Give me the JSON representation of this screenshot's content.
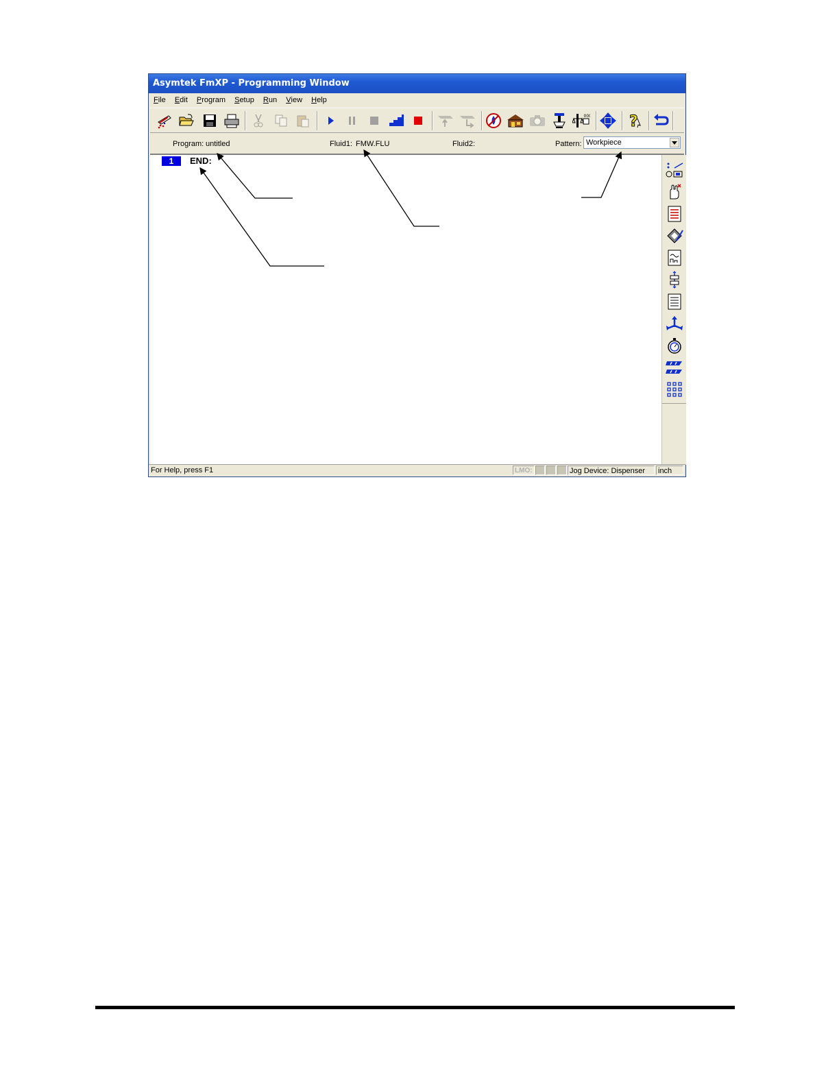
{
  "window": {
    "title": "Asymtek FmXP - Programming Window"
  },
  "menu": [
    {
      "label": "File",
      "accel": "F",
      "rest": "ile"
    },
    {
      "label": "Edit",
      "accel": "E",
      "rest": "dit"
    },
    {
      "label": "Program",
      "accel": "P",
      "rest": "rogram"
    },
    {
      "label": "Setup",
      "accel": "S",
      "rest": "etup"
    },
    {
      "label": "Run",
      "accel": "R",
      "rest": "un"
    },
    {
      "label": "View",
      "accel": "V",
      "rest": "iew"
    },
    {
      "label": "Help",
      "accel": "H",
      "rest": "elp"
    }
  ],
  "toolbar": {
    "icons": [
      "new-program-icon",
      "open-folder-icon",
      "save-icon",
      "print-icon",
      "cut-icon",
      "copy-icon",
      "paste-icon",
      "run-icon",
      "pause-icon",
      "stop-icon",
      "step-icon",
      "abort-icon",
      "move-up-icon",
      "move-down-icon",
      "fluid-icon",
      "home-icon",
      "camera-icon",
      "dispenser-icon",
      "scale-icon",
      "jog-icon",
      "help-icon",
      "undo-icon"
    ]
  },
  "info": {
    "program_label": "Program:",
    "program_value": "untitled",
    "fluid1_label": "Fluid1:",
    "fluid1_value": "FMW.FLU",
    "fluid2_label": "Fluid2:",
    "pattern_label": "Pattern:",
    "pattern_value": "Workpiece"
  },
  "editor": {
    "lines": [
      {
        "number": "1",
        "text": "END:"
      }
    ]
  },
  "sidebar": {
    "icons": [
      "dot-line-icon",
      "hand-icon",
      "document-list-icon",
      "wrench-icon",
      "chart-icon",
      "align-icon",
      "document-icon",
      "move-arrows-icon",
      "timer-icon",
      "z-axis-icon",
      "grid-array-icon"
    ]
  },
  "status": {
    "help": "For Help, press F1",
    "lmo": "LMO:",
    "jog_device": "Jog Device: Dispenser",
    "units": "inch"
  },
  "colors": {
    "title_blue": "#1f5ad2",
    "line_number_bg": "#0000e0",
    "stop_red": "#e00000",
    "icon_blue": "#1030d0"
  }
}
